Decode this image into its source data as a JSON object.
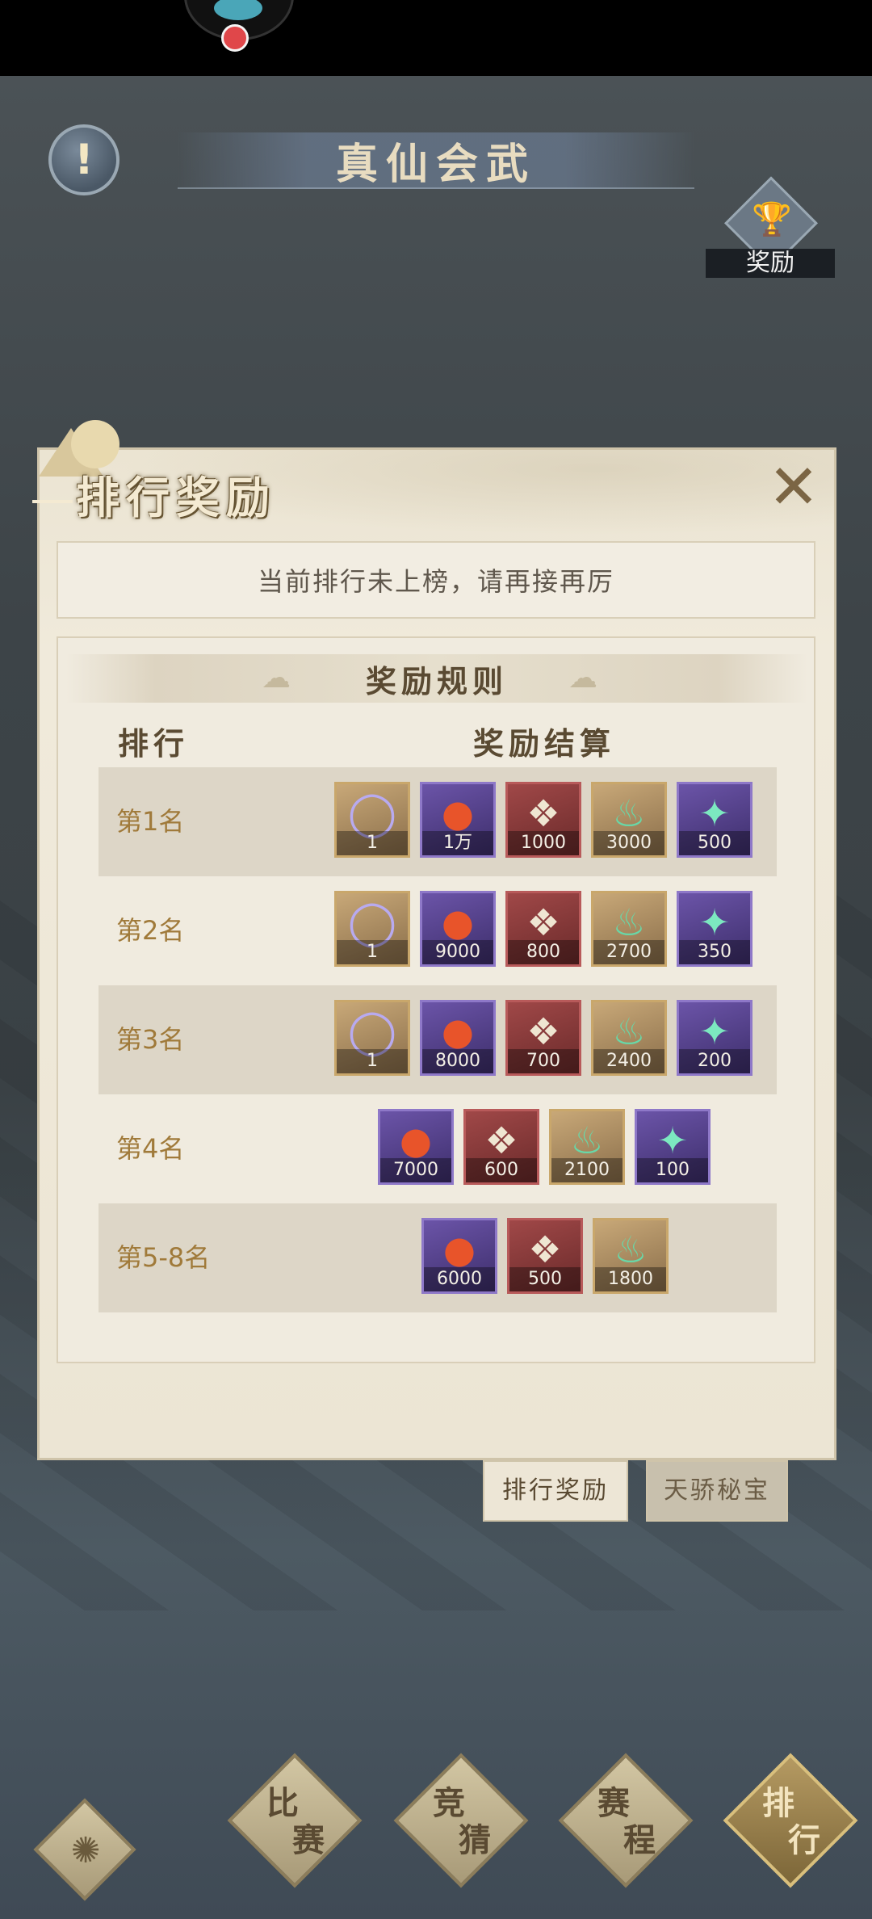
{
  "header": {
    "title": "真仙会武",
    "info_icon": "exclamation-icon",
    "reward_button_label": "奖励"
  },
  "panel": {
    "title": "排行奖励",
    "notice": "当前排行未上榜，请再接再厉",
    "rules_title": "奖励规则",
    "col_rank": "排行",
    "col_reward": "奖励结算",
    "rows": [
      {
        "rank": "第1名",
        "items": [
          {
            "type": "ring",
            "count": "1"
          },
          {
            "type": "pearl",
            "count": "1万"
          },
          {
            "type": "token",
            "count": "1000"
          },
          {
            "type": "jade",
            "count": "3000"
          },
          {
            "type": "flame",
            "count": "500"
          }
        ]
      },
      {
        "rank": "第2名",
        "items": [
          {
            "type": "ring",
            "count": "1"
          },
          {
            "type": "pearl",
            "count": "9000"
          },
          {
            "type": "token",
            "count": "800"
          },
          {
            "type": "jade",
            "count": "2700"
          },
          {
            "type": "flame",
            "count": "350"
          }
        ]
      },
      {
        "rank": "第3名",
        "items": [
          {
            "type": "ring",
            "count": "1"
          },
          {
            "type": "pearl",
            "count": "8000"
          },
          {
            "type": "token",
            "count": "700"
          },
          {
            "type": "jade",
            "count": "2400"
          },
          {
            "type": "flame",
            "count": "200"
          }
        ]
      },
      {
        "rank": "第4名",
        "items": [
          {
            "type": "pearl",
            "count": "7000"
          },
          {
            "type": "token",
            "count": "600"
          },
          {
            "type": "jade",
            "count": "2100"
          },
          {
            "type": "flame",
            "count": "100"
          }
        ]
      },
      {
        "rank": "第5-8名",
        "items": [
          {
            "type": "pearl",
            "count": "6000"
          },
          {
            "type": "token",
            "count": "500"
          },
          {
            "type": "jade",
            "count": "1800"
          }
        ]
      }
    ]
  },
  "tabs": [
    "排行奖励",
    "天骄秘宝"
  ],
  "bottom_nav": [
    {
      "top": "比",
      "bottom": "赛"
    },
    {
      "top": "竞",
      "bottom": "猜"
    },
    {
      "top": "赛",
      "bottom": "程"
    },
    {
      "top": "排",
      "bottom": "行"
    }
  ],
  "colors": {
    "rank_text": "#a07a3a",
    "panel_bg": "#ece5d4"
  }
}
